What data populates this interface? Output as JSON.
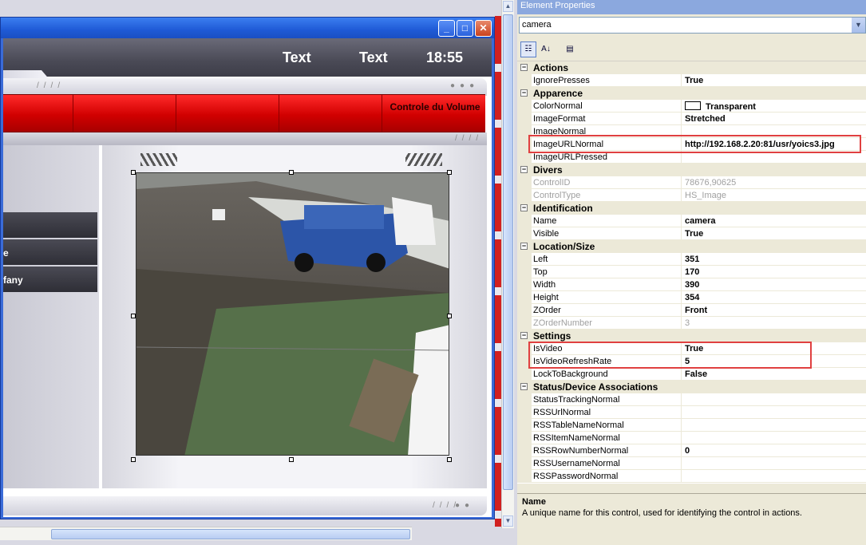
{
  "designer": {
    "header_text1": "Text",
    "header_text2": "Text",
    "clock": "18:55",
    "volume_label": "Controle du Volume",
    "nav_items": [
      "",
      "e",
      "fany"
    ],
    "window_buttons": {
      "minimize": "_",
      "maximize": "□",
      "close": "✕"
    }
  },
  "properties": {
    "title": "Element Properties",
    "selected_object": "camera",
    "rows": [
      {
        "type": "cat",
        "name": "Actions"
      },
      {
        "type": "prop",
        "name": "IgnorePresses",
        "value": "True"
      },
      {
        "type": "cat",
        "name": "Apparence"
      },
      {
        "type": "prop",
        "name": "ColorNormal",
        "value": "Transparent",
        "swatch": "#ffffff"
      },
      {
        "type": "prop",
        "name": "ImageFormat",
        "value": "Stretched"
      },
      {
        "type": "prop",
        "name": "ImageNormal",
        "value": ""
      },
      {
        "type": "prop",
        "name": "ImageURLNormal",
        "value": "http://192.168.2.20:81/usr/yoics3.jpg"
      },
      {
        "type": "prop",
        "name": "ImageURLPressed",
        "value": ""
      },
      {
        "type": "cat",
        "name": "Divers"
      },
      {
        "type": "prop",
        "name": "ControlID",
        "value": "78676,90625",
        "readonly": true
      },
      {
        "type": "prop",
        "name": "ControlType",
        "value": "HS_Image",
        "readonly": true
      },
      {
        "type": "cat",
        "name": "Identification"
      },
      {
        "type": "prop",
        "name": "Name",
        "value": "camera"
      },
      {
        "type": "prop",
        "name": "Visible",
        "value": "True"
      },
      {
        "type": "cat",
        "name": "Location/Size"
      },
      {
        "type": "prop",
        "name": "Left",
        "value": "351"
      },
      {
        "type": "prop",
        "name": "Top",
        "value": "170"
      },
      {
        "type": "prop",
        "name": "Width",
        "value": "390"
      },
      {
        "type": "prop",
        "name": "Height",
        "value": "354"
      },
      {
        "type": "prop",
        "name": "ZOrder",
        "value": "Front"
      },
      {
        "type": "prop",
        "name": "ZOrderNumber",
        "value": "3",
        "readonly": true
      },
      {
        "type": "cat",
        "name": "Settings"
      },
      {
        "type": "prop",
        "name": "IsVideo",
        "value": "True"
      },
      {
        "type": "prop",
        "name": "IsVideoRefreshRate",
        "value": "5"
      },
      {
        "type": "prop",
        "name": "LockToBackground",
        "value": "False"
      },
      {
        "type": "cat",
        "name": "Status/Device Associations"
      },
      {
        "type": "prop",
        "name": "StatusTrackingNormal",
        "value": ""
      },
      {
        "type": "prop",
        "name": "RSSUrlNormal",
        "value": ""
      },
      {
        "type": "prop",
        "name": "RSSTableNameNormal",
        "value": ""
      },
      {
        "type": "prop",
        "name": "RSSItemNameNormal",
        "value": ""
      },
      {
        "type": "prop",
        "name": "RSSRowNumberNormal",
        "value": "0"
      },
      {
        "type": "prop",
        "name": "RSSUsernameNormal",
        "value": ""
      },
      {
        "type": "prop",
        "name": "RSSPasswordNormal",
        "value": ""
      }
    ],
    "description": {
      "title": "Name",
      "text": "A unique name for this control, used for identifying the control in actions."
    }
  }
}
